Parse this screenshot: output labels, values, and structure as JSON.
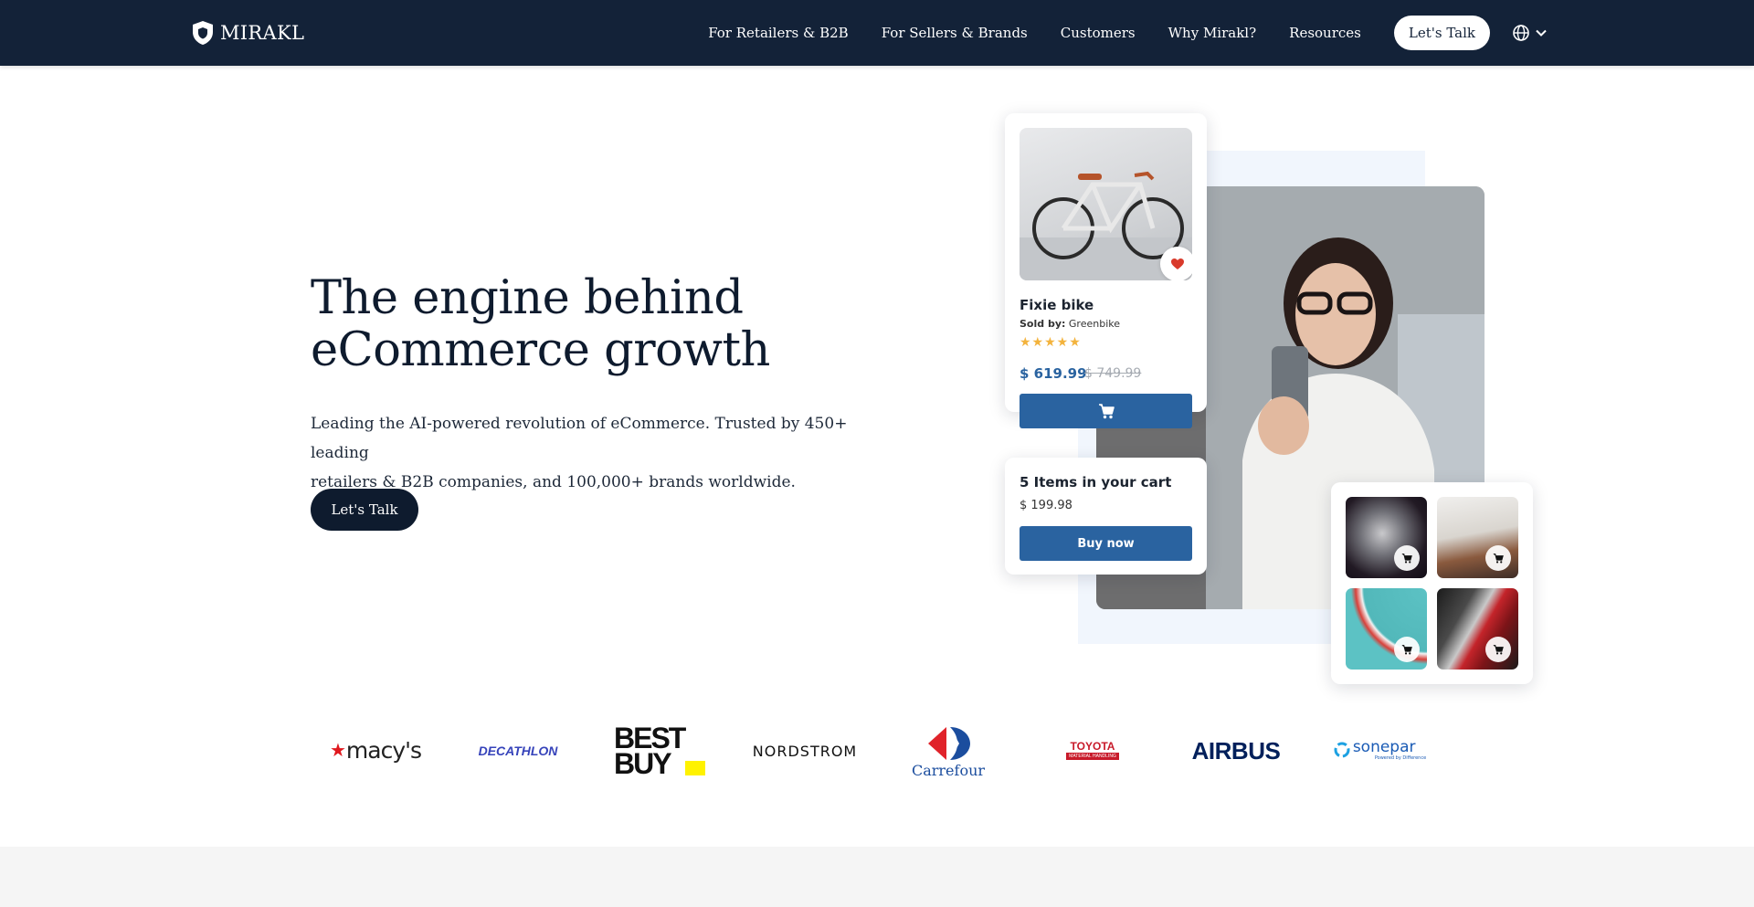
{
  "nav": {
    "brand": "MIRAKL",
    "links": [
      "For Retailers & B2B",
      "For Sellers & Brands",
      "Customers",
      "Why Mirakl?",
      "Resources"
    ],
    "cta": "Let's Talk",
    "language_icon": "globe-icon"
  },
  "hero": {
    "title_line1": "The engine behind",
    "title_line2": "eCommerce growth",
    "subtitle_line1": "Leading the AI-powered revolution of eCommerce. Trusted by 450+ leading",
    "subtitle_line2": "retailers & B2B companies, and 100,000+ brands worldwide.",
    "cta": "Let's Talk"
  },
  "product_card": {
    "name": "Fixie bike",
    "sold_by_label": "Sold by:",
    "seller": "Greenbike",
    "rating": 5,
    "price": "$ 619.99",
    "old_price": "$ 749.99"
  },
  "cart_card": {
    "title": "5 Items in your cart",
    "total": "$ 199.98",
    "button": "Buy now"
  },
  "logos": {
    "macys": "macy's",
    "decathlon": "DECATHLON",
    "bestbuy_line1": "BEST",
    "bestbuy_line2": "BUY",
    "nordstrom": "NORDSTROM",
    "carrefour": "Carrefour",
    "toyota_line1": "TOYOTA",
    "toyota_line2": "MATERIAL HANDLING",
    "airbus": "AIRBUS",
    "sonepar": "sonepar",
    "sonepar_tag": "Powered by Difference"
  },
  "colors": {
    "nav_bg": "#132238",
    "brand_blue": "#2a63a0",
    "dark": "#0e1b2e",
    "star": "#f3b33d",
    "heart": "#d93a2b"
  }
}
